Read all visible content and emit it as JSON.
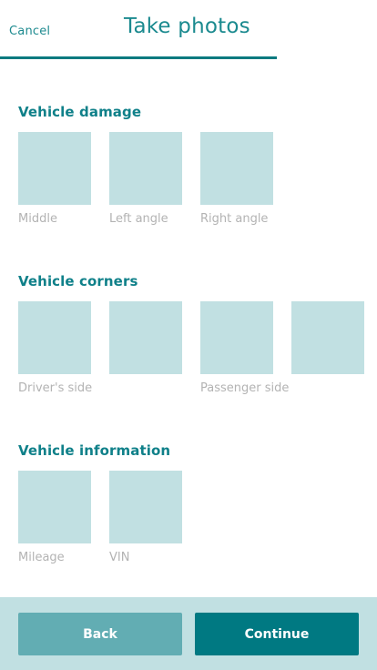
{
  "header": {
    "cancel_label": "Cancel",
    "title": "Take photos"
  },
  "sections": [
    {
      "title": "Vehicle damage",
      "tiles": [
        {
          "label": "Middle"
        },
        {
          "label": "Left angle"
        },
        {
          "label": "Right angle"
        }
      ]
    },
    {
      "title": "Vehicle corners",
      "tiles": [
        {
          "label": "Driver's side"
        },
        {
          "label": ""
        },
        {
          "label": "Passenger side"
        },
        {
          "label": ""
        }
      ]
    },
    {
      "title": "Vehicle information",
      "tiles": [
        {
          "label": "Mileage"
        },
        {
          "label": "VIN"
        }
      ]
    }
  ],
  "footer": {
    "back_label": "Back",
    "continue_label": "Continue"
  },
  "colors": {
    "accent": "#007982",
    "tile": "#c1e0e2",
    "label": "#b3b3b3"
  }
}
